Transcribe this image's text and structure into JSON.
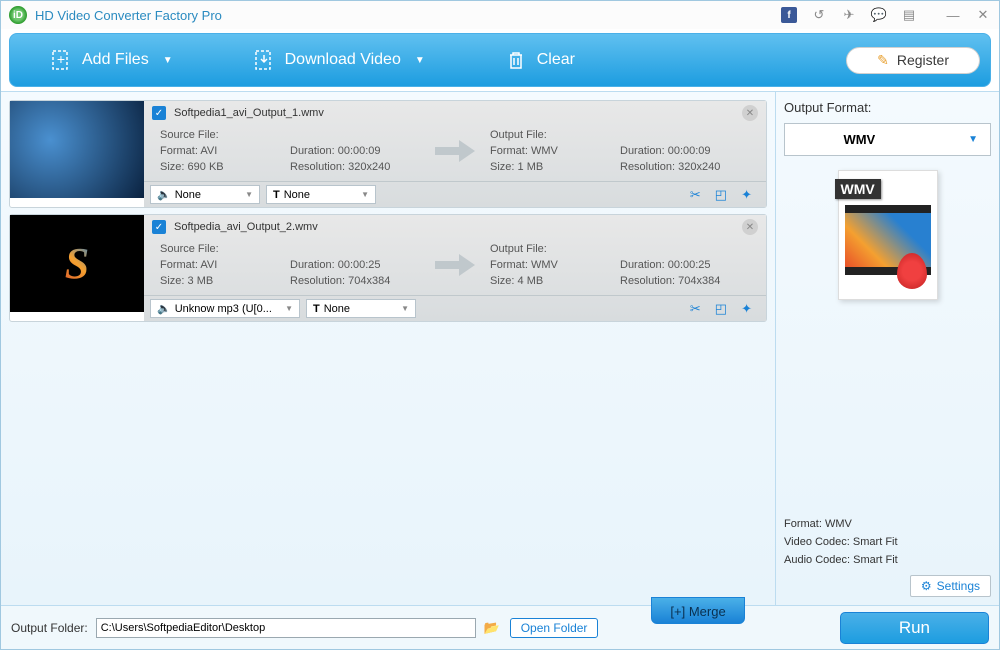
{
  "app": {
    "title": "HD Video Converter Factory Pro"
  },
  "toolbar": {
    "add_files": "Add Files",
    "download_video": "Download Video",
    "clear": "Clear",
    "register": "Register"
  },
  "items": [
    {
      "filename": "Softpedia1_avi_Output_1.wmv",
      "source": {
        "label": "Source File:",
        "format_label": "Format:",
        "format": "AVI",
        "duration_label": "Duration:",
        "duration": "00:00:09",
        "size_label": "Size:",
        "size": "690 KB",
        "res_label": "Resolution:",
        "res": "320x240"
      },
      "output": {
        "label": "Output File:",
        "format_label": "Format:",
        "format": "WMV",
        "duration_label": "Duration:",
        "duration": "00:00:09",
        "size_label": "Size:",
        "size": "1 MB",
        "res_label": "Resolution:",
        "res": "320x240"
      },
      "audio_dd": "None",
      "subtitle_dd": "None"
    },
    {
      "filename": "Softpedia_avi_Output_2.wmv",
      "source": {
        "label": "Source File:",
        "format_label": "Format:",
        "format": "AVI",
        "duration_label": "Duration:",
        "duration": "00:00:25",
        "size_label": "Size:",
        "size": "3 MB",
        "res_label": "Resolution:",
        "res": "704x384"
      },
      "output": {
        "label": "Output File:",
        "format_label": "Format:",
        "format": "WMV",
        "duration_label": "Duration:",
        "duration": "00:00:25",
        "size_label": "Size:",
        "size": "4 MB",
        "res_label": "Resolution:",
        "res": "704x384"
      },
      "audio_dd": "Unknow mp3 (U[0...",
      "subtitle_dd": "None"
    }
  ],
  "side": {
    "title": "Output Format:",
    "format": "WMV",
    "info_format_label": "Format:",
    "info_format": "WMV",
    "info_vcodec_label": "Video Codec:",
    "info_vcodec": "Smart Fit",
    "info_acodec_label": "Audio Codec:",
    "info_acodec": "Smart Fit",
    "settings": "Settings"
  },
  "footer": {
    "output_label": "Output Folder:",
    "output_path": "C:\\Users\\SoftpediaEditor\\Desktop",
    "open_folder": "Open Folder",
    "merge": "[+] Merge",
    "run": "Run"
  },
  "sub_prefix": "T "
}
